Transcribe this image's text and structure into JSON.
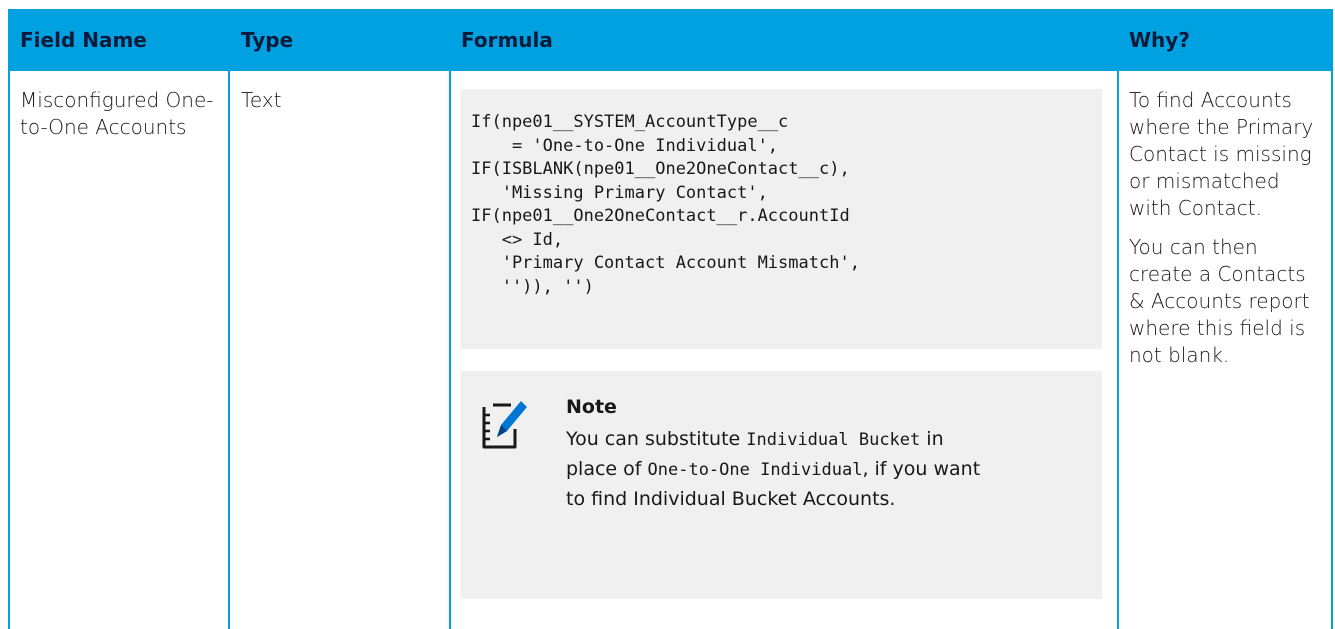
{
  "table": {
    "headers": {
      "field_name": "Field Name",
      "type": "Type",
      "formula": "Formula",
      "why": "Why?"
    },
    "row": {
      "field_name": "Misconfigured One-to-One Accounts",
      "type": "Text",
      "formula_code": "If(npe01__SYSTEM_AccountType__c\n    = 'One-to-One Individual',\nIF(ISBLANK(npe01__One2OneContact__c),\n   'Missing Primary Contact',\nIF(npe01__One2OneContact__r.AccountId\n   <> Id,\n   'Primary Contact Account Mismatch',\n   '')), '')",
      "note": {
        "icon": "note-pencil-icon",
        "title": "Note",
        "text_1": "You can substitute ",
        "code_1": "Individual Bucket",
        "text_2": " in place of ",
        "code_2": "One-to-One Individual",
        "text_3": ", if you want to find Individual Bucket Accounts."
      },
      "why_1": "To find Accounts where the Primary Contact is missing or mismatched with Contact.",
      "why_2": "You can then create a Contacts & Accounts report where this field is not blank."
    }
  },
  "colors": {
    "header_bg": "#00a1e0",
    "header_text": "#0a1a3a",
    "box_bg": "#f0f0f0"
  }
}
